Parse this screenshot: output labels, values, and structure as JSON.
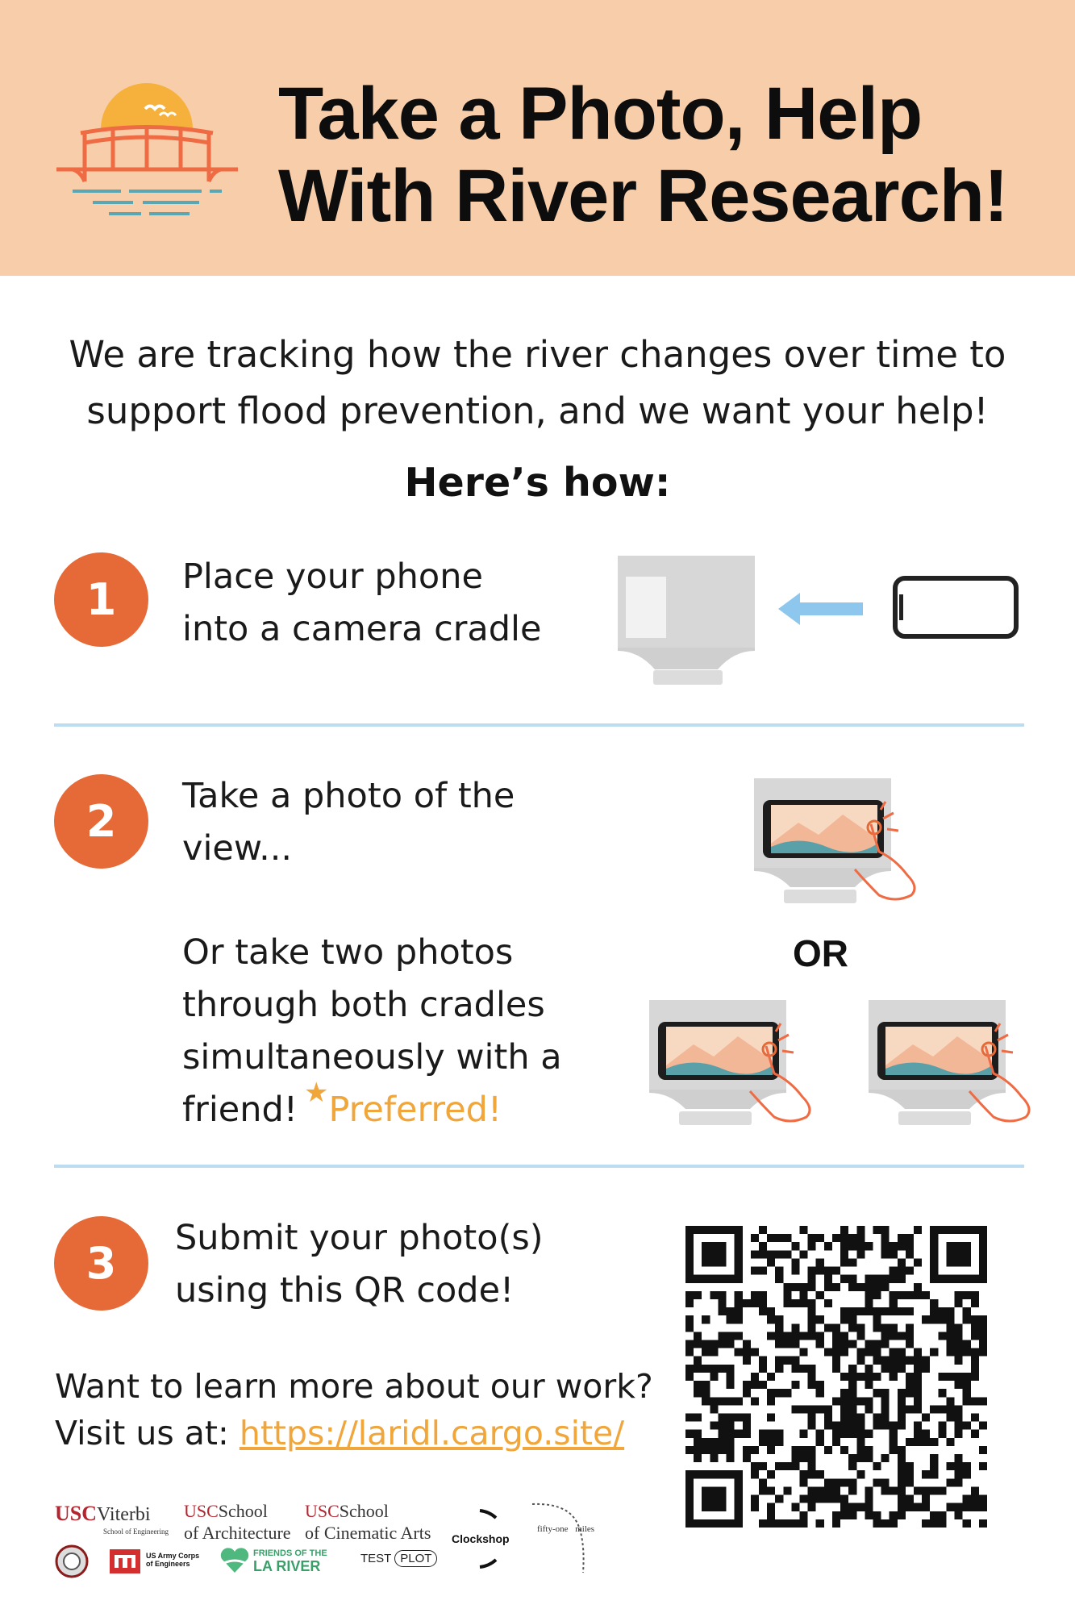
{
  "header": {
    "title_line1": "Take a Photo, Help",
    "title_line2": "With River Research!",
    "logo_icon": "bridge-sunset-logo-icon"
  },
  "intro": {
    "line1": "We are tracking how the river changes over time to",
    "line2": "support flood prevention, and we want your help!"
  },
  "howto": "Here’s how:",
  "steps": [
    {
      "number": "1",
      "line1": "Place your phone",
      "line2": "into a camera cradle"
    },
    {
      "number": "2",
      "line1": "Take a photo of the",
      "line2": "view...",
      "alt_line1": "Or take two photos",
      "alt_line2": "through both cradles",
      "alt_line3": "simultaneously with a",
      "alt_line4": "friend!",
      "preferred": "Preferred!",
      "star": "★"
    },
    {
      "number": "3",
      "line1": "Submit your photo(s)",
      "line2": "using this QR code!"
    }
  ],
  "or_label": "OR",
  "learn": {
    "line1": "Want to learn more about our work?",
    "line2_prefix": "Visit us at: ",
    "link": "https://laridl.cargo.site/"
  },
  "partners": {
    "usc": "USC",
    "viterbi": "Viterbi",
    "viterbi_sub": "School of Engineering",
    "school": "School",
    "architecture": "of Architecture",
    "cinematic": "of Cinematic Arts",
    "clockshop": "Clockshop",
    "fifty_one": "fifty-one",
    "miles": "miles",
    "army_line1": "US Army Corps",
    "army_line2": "of Engineers",
    "friends_line1": "FRIENDS OF THE",
    "friends_line2": "LA RIVER",
    "test": "TEST",
    "plot": "PLOT"
  },
  "colors": {
    "header_bg": "#f8ceaa",
    "accent_orange": "#e66a37",
    "preferred_gold": "#f0a63b",
    "divider_blue": "#bcdcf2"
  }
}
